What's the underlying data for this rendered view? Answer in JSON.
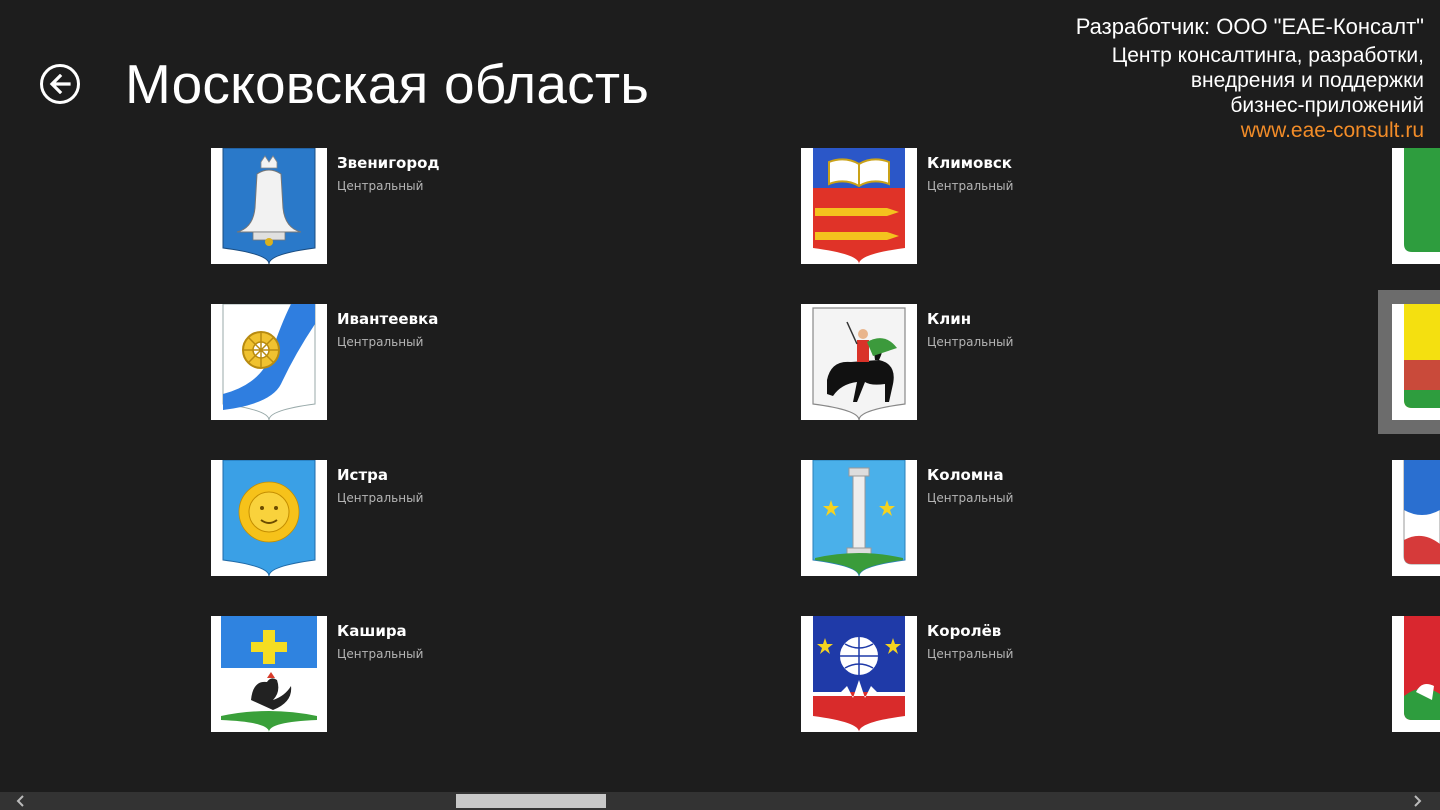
{
  "header": {
    "title": "Московская область"
  },
  "developer": {
    "line1": "Разработчик: ООО \"ЕАЕ-Консалт\"",
    "line2": "Центр консалтинга, разработки,",
    "line3": "внедрения и поддержки",
    "line4": "бизнес-приложений",
    "website": "www.eae-consult.ru"
  },
  "cities": [
    {
      "name": "Звенигород",
      "region": "Центральный",
      "icon": "zvenigorod-coat-of-arms-icon"
    },
    {
      "name": "Ивантеевка",
      "region": "Центральный",
      "icon": "ivanteevka-coat-of-arms-icon"
    },
    {
      "name": "Истра",
      "region": "Центральный",
      "icon": "istra-coat-of-arms-icon"
    },
    {
      "name": "Кашира",
      "region": "Центральный",
      "icon": "kashira-coat-of-arms-icon"
    },
    {
      "name": "Климовск",
      "region": "Центральный",
      "icon": "klimovsk-coat-of-arms-icon"
    },
    {
      "name": "Клин",
      "region": "Центральный",
      "icon": "klin-coat-of-arms-icon"
    },
    {
      "name": "Коломна",
      "region": "Центральный",
      "icon": "kolomna-coat-of-arms-icon"
    },
    {
      "name": "Королёв",
      "region": "Центральный",
      "icon": "korolev-coat-of-arms-icon"
    }
  ],
  "colors": {
    "background": "#1d1d1d",
    "link": "#f28c28",
    "subtext": "#b5b5b5",
    "selection": "#6c6c6c"
  },
  "scrollbar": {
    "thumb_position": 0.32
  }
}
